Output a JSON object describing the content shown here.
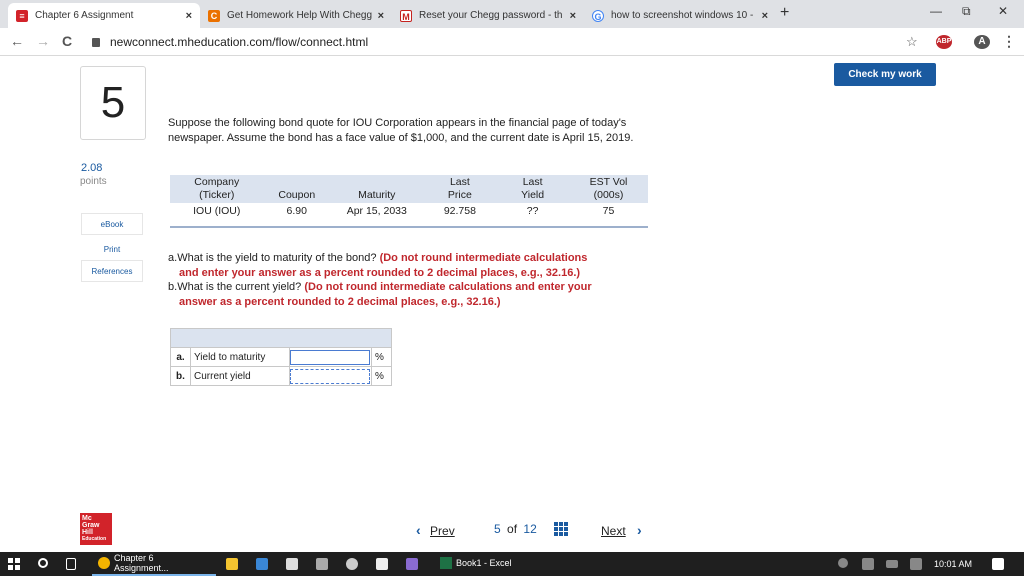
{
  "browser": {
    "tabs": [
      {
        "title": "Chapter 6 Assignment",
        "close": "×"
      },
      {
        "title": "Get Homework Help With Chegg",
        "close": "×"
      },
      {
        "title": "Reset your Chegg password - th",
        "close": "×"
      },
      {
        "title": "how to screenshot windows 10 -",
        "close": "×"
      }
    ],
    "new_tab": "+",
    "window_controls": {
      "minimize": "—",
      "restore": "⧉",
      "close": "✕"
    },
    "url": "newconnect.mheducation.com/flow/connect.html",
    "extensions": [
      "ABP"
    ],
    "nav": {
      "back": "←",
      "forward": "→",
      "reload": "C"
    }
  },
  "question": {
    "number": "5",
    "points_value": "2.08",
    "points_label": "points",
    "side_buttons": [
      "eBook",
      "Print",
      "References"
    ],
    "check_button": "Check my work",
    "problem_text": "Suppose the following bond quote for IOU Corporation appears in the financial page of today's newspaper. Assume the bond has a face value of $1,000, and the current date is April 15, 2019.",
    "bond_table": {
      "headers": [
        [
          "Company",
          "(Ticker)"
        ],
        [
          "Coupon"
        ],
        [
          "Maturity"
        ],
        [
          "Last",
          "Price"
        ],
        [
          "Last",
          "Yield"
        ],
        [
          "EST Vol",
          "(000s)"
        ]
      ],
      "row": [
        "IOU (IOU)",
        "6.90",
        "Apr 15, 2033",
        "92.758",
        "??",
        "75"
      ]
    },
    "part_a_prefix": "a.",
    "part_a_text": "What is the yield to maturity of the bond?",
    "part_a_instr_1": "(Do not round intermediate calculations",
    "part_a_instr_2": "and enter your answer as a percent rounded to 2 decimal places, e.g., 32.16.)",
    "part_b_prefix": "b.",
    "part_b_text": "What is the current yield?",
    "part_b_instr_1": "(Do not round intermediate calculations and enter your",
    "part_b_instr_2": "answer as a percent rounded to 2 decimal places, e.g., 32.16.)",
    "answers": [
      {
        "letter": "a.",
        "label": "Yield to maturity",
        "value": "",
        "unit": "%"
      },
      {
        "letter": "b.",
        "label": "Current yield",
        "value": "",
        "unit": "%"
      }
    ]
  },
  "footer": {
    "logo_lines": [
      "Mc",
      "Graw",
      "Hill",
      "Education"
    ],
    "prev": "Prev",
    "current": "5",
    "of": "of",
    "total": "12",
    "next": "Next"
  },
  "taskbar": {
    "apps": [
      {
        "label": "Chapter 6 Assignment..."
      },
      {
        "label": "Book1 - Excel"
      }
    ],
    "time": "10:01 AM"
  },
  "colors": {
    "brand_blue": "#1a5aa0",
    "instruction_red": "#c0272d",
    "table_header": "#dbe3ef",
    "mgh_red": "#d2232a"
  }
}
